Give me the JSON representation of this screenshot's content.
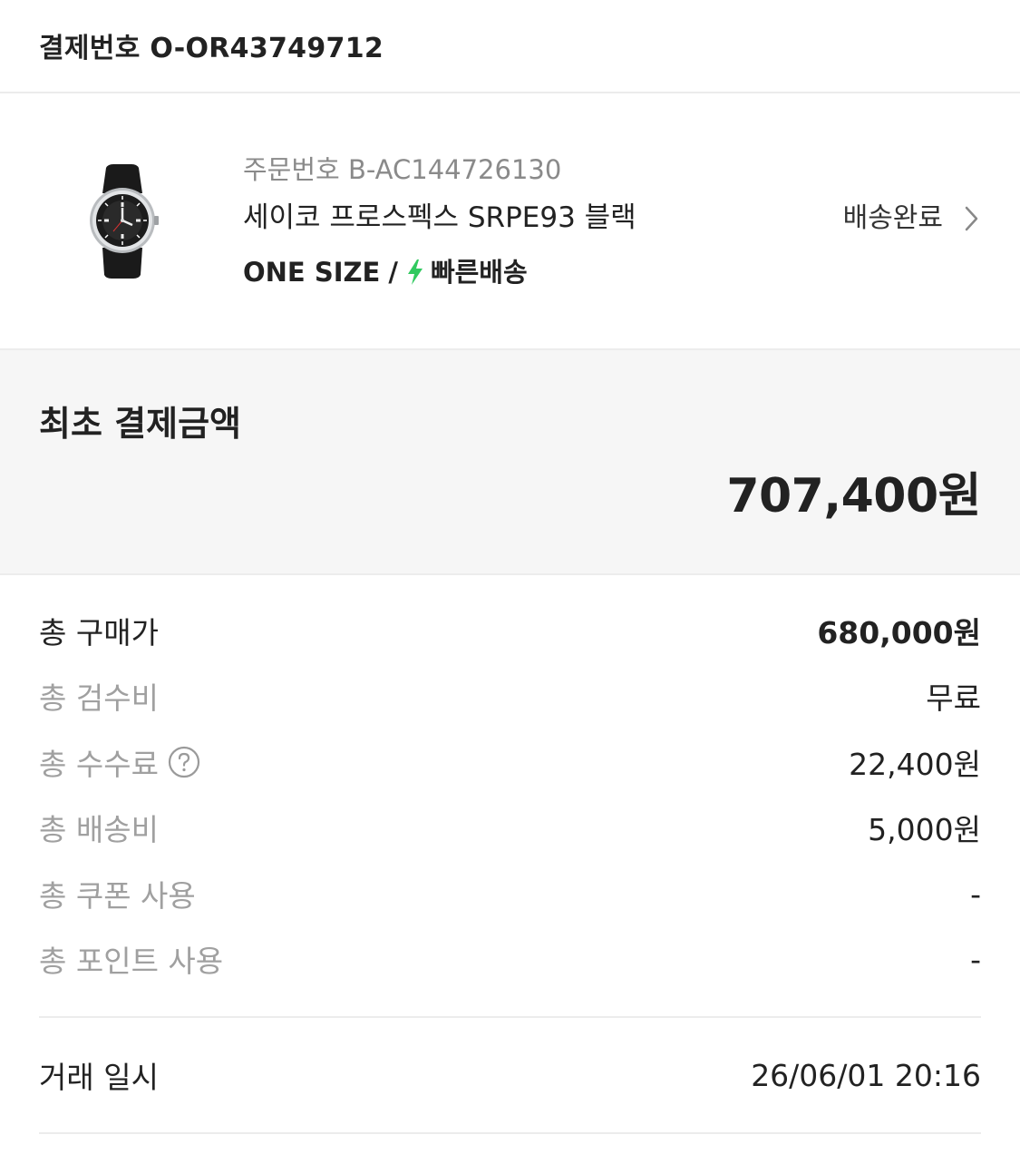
{
  "header": {
    "title": "결제번호 O-OR43749712"
  },
  "product": {
    "order_no": "주문번호 B-AC144726130",
    "name": "세이코 프로스펙스 SRPE93 블랙",
    "size": "ONE SIZE",
    "separator": "/",
    "shipping_type": "빠른배송",
    "status": "배송완료"
  },
  "initial_payment": {
    "title": "최초 결제금액",
    "amount": "707,400원"
  },
  "breakdown": {
    "total_price_label": "총 구매가",
    "total_price_value": "680,000원",
    "inspection_label": "총 검수비",
    "inspection_value": "무료",
    "fee_label": "총 수수료",
    "fee_value": "22,400원",
    "shipping_label": "총 배송비",
    "shipping_value": "5,000원",
    "coupon_label": "총 쿠폰 사용",
    "coupon_value": "-",
    "point_label": "총 포인트 사용",
    "point_value": "-"
  },
  "transaction": {
    "label": "거래 일시",
    "value": "26/06/01 20:16"
  },
  "colors": {
    "bolt": "#31c95f",
    "muted_text": "#a0a0a0",
    "panel_bg": "#f6f6f6"
  }
}
